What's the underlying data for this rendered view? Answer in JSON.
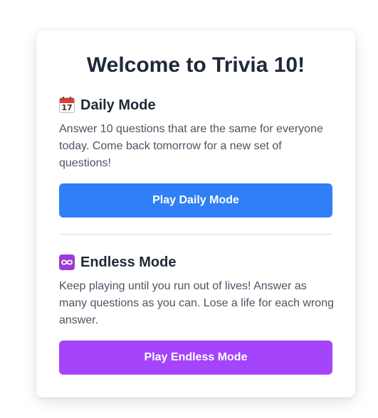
{
  "title": "Welcome to Trivia 10!",
  "daily": {
    "icon": "calendar-icon",
    "icon_text": "17",
    "heading": "Daily Mode",
    "description": "Answer 10 questions that are the same for everyone today. Come back tomorrow for a new set of questions!",
    "button_label": "Play Daily Mode",
    "button_color": "#2f7ff7"
  },
  "endless": {
    "icon": "infinity-icon",
    "heading": "Endless Mode",
    "description": "Keep playing until you run out of lives! Answer as many questions as you can. Lose a life for each wrong answer.",
    "button_label": "Play Endless Mode",
    "button_color": "#a444fb"
  }
}
